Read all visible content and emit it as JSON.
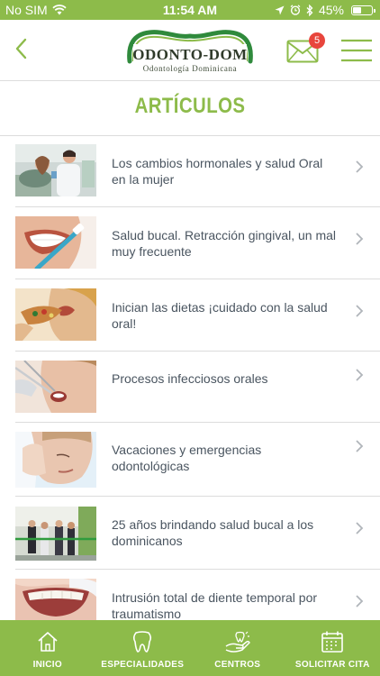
{
  "status_bar": {
    "carrier": "No SIM",
    "time": "11:54 AM",
    "battery": "45%",
    "battery_level": 0.45
  },
  "header": {
    "logo_main": "ODONTO-DOM",
    "logo_sub": "Odontología Dominicana",
    "mail_badge": "5"
  },
  "page_title": "ARTÍCULOS",
  "articles": [
    {
      "title": "Los cambios hormonales y salud Oral en la mujer",
      "image": "dentist-patient-photo"
    },
    {
      "title": "Salud bucal. Retracción gingival, un mal muy frecuente",
      "image": "woman-brushing-teeth-photo"
    },
    {
      "title": "Inician las dietas ¡cuidado con la salud oral!",
      "image": "woman-eating-photo"
    },
    {
      "title": "Procesos infecciosos orales",
      "image": "dental-exam-photo"
    },
    {
      "title": "Vacaciones y emergencias odontológicas",
      "image": "woman-toothache-photo"
    },
    {
      "title": "25 años brindando salud bucal a los dominicanos",
      "image": "ribbon-cutting-photo"
    },
    {
      "title": "Intrusión total de diente temporal por traumatismo",
      "image": "child-teeth-photo"
    }
  ],
  "tabs": [
    {
      "label": "INICIO",
      "icon": "home-icon"
    },
    {
      "label": "ESPECIALIDADES",
      "icon": "tooth-icon"
    },
    {
      "label": "CENTROS",
      "icon": "hand-care-icon"
    },
    {
      "label": "SOLICITAR CITA",
      "icon": "calendar-icon"
    }
  ],
  "colors": {
    "accent": "#8dbb4a",
    "badge": "#e8453c",
    "text": "#4a5560"
  }
}
